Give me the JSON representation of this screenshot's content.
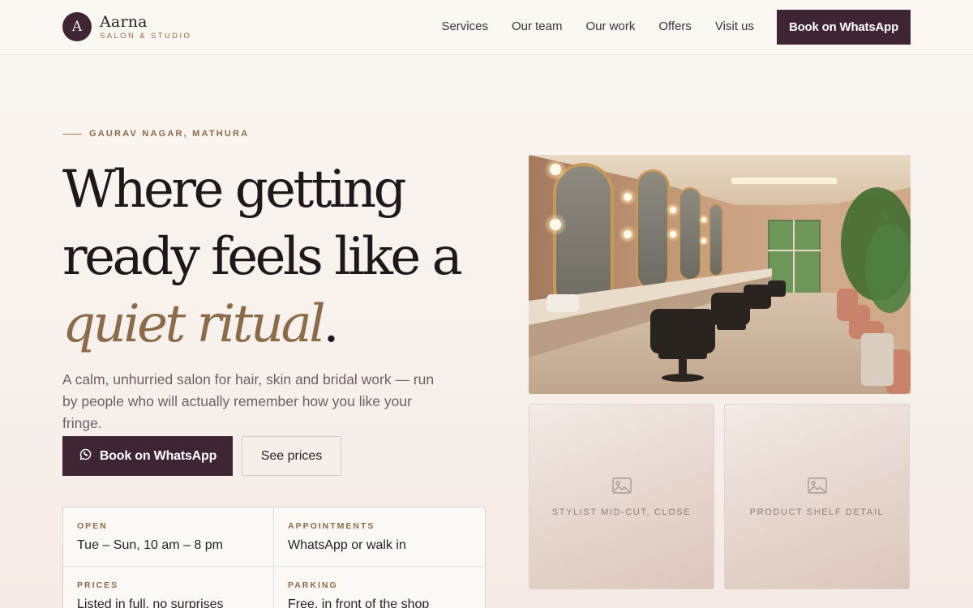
{
  "brand": {
    "initial": "A",
    "name": "Aarna",
    "tagline": "SALON & STUDIO"
  },
  "nav": {
    "items": [
      {
        "label": "Services"
      },
      {
        "label": "Our team"
      },
      {
        "label": "Our work"
      },
      {
        "label": "Offers"
      },
      {
        "label": "Visit us"
      }
    ],
    "cta_label": "Book on WhatsApp"
  },
  "hero": {
    "eyebrow": "GAURAV NAGAR, MATHURA",
    "headline_line1": "Where getting",
    "headline_line2": "ready feels like a",
    "headline_accent": "quiet ritual",
    "headline_period": ".",
    "lede": "A calm, unhurried salon for hair, skin and bridal work — run by people who will actually remember how you like your fringe.",
    "primary_cta": "Book on WhatsApp",
    "primary_cta_icon": "whatsapp-icon",
    "secondary_cta": "See prices"
  },
  "info": [
    {
      "label": "OPEN",
      "value": "Tue – Sun, 10 am – 8 pm"
    },
    {
      "label": "APPOINTMENTS",
      "value": "WhatsApp or walk in"
    },
    {
      "label": "PRICES",
      "value": "Listed in full, no surprises"
    },
    {
      "label": "PARKING",
      "value": "Free, in front of the shop"
    }
  ],
  "gallery": {
    "main_photo": "salon-interior-photo",
    "tiles": [
      {
        "label": "STYLIST MID-CUT, CLOSE",
        "icon": "image-placeholder-icon"
      },
      {
        "label": "PRODUCT SHELF DETAIL",
        "icon": "image-placeholder-icon"
      }
    ]
  },
  "colors": {
    "brand_plum": "#3f2433",
    "accent_bronze": "#8c6b4a",
    "background": "#faf7f3"
  }
}
